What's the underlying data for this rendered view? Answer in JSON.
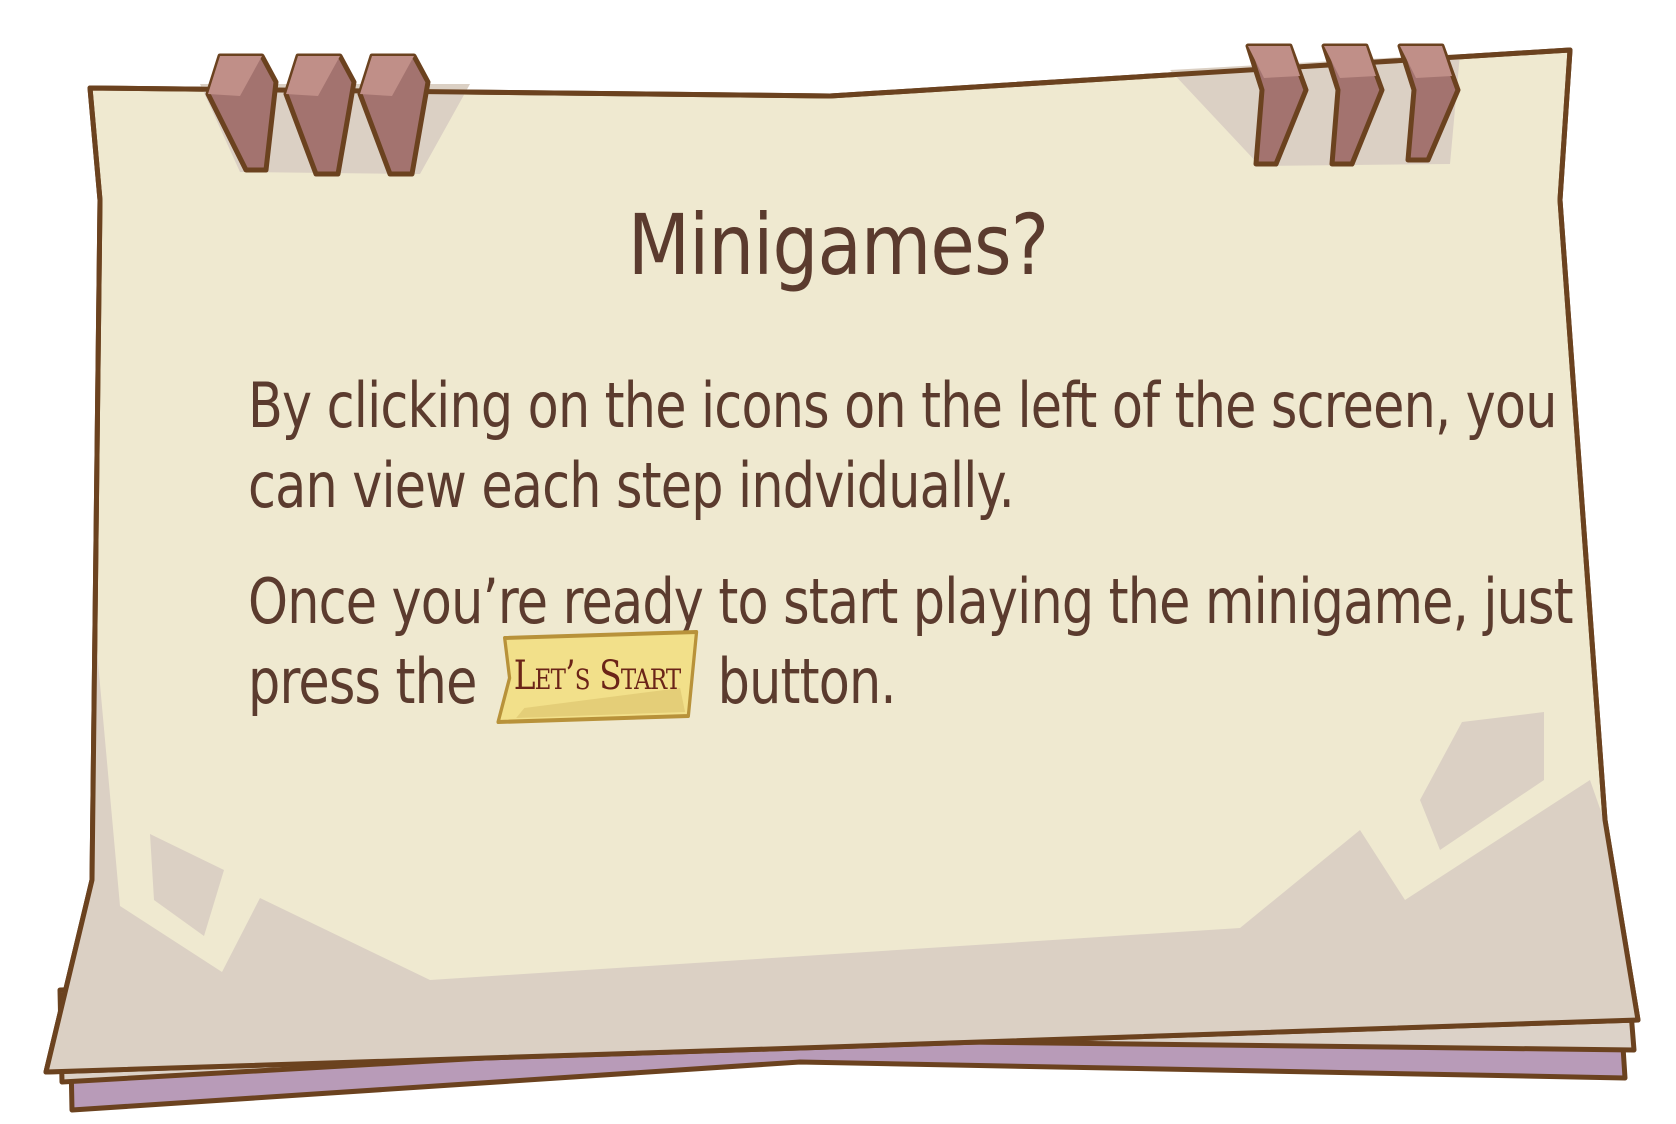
{
  "dialog": {
    "title": "Minigames?",
    "paragraph1": {
      "line1": "By clicking on the icons on the left of the screen, you",
      "line2": "can view each step indvidually."
    },
    "paragraph2": {
      "line1": "Once you’re ready to start playing the minigame, just",
      "line2_before": "press the",
      "button_label": "Let’s Start",
      "line2_after": "button."
    }
  },
  "colors": {
    "paper": "#efe9d0",
    "paper_shadow": "#dbd0c4",
    "outline": "#6b421f",
    "ring": "#a3736f",
    "bottom_page": "#b89bb8",
    "text": "#5b3b2e",
    "button_fill": "#f2e08a",
    "button_text": "#6b2418"
  },
  "icons": {
    "left_rings": "binder-ring-icon",
    "right_rings": "binder-ring-icon"
  }
}
